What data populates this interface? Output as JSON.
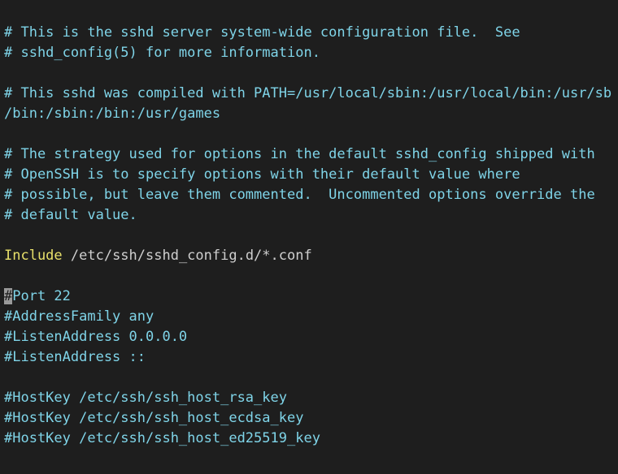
{
  "editor": {
    "file_lines": [
      "# This is the sshd server system-wide configuration file.  See",
      "# sshd_config(5) for more information.",
      "",
      "# This sshd was compiled with PATH=/usr/local/sbin:/usr/local/bin:/usr/sb",
      "/bin:/sbin:/bin:/usr/games",
      "",
      "# The strategy used for options in the default sshd_config shipped with",
      "# OpenSSH is to specify options with their default value where",
      "# possible, but leave them commented.  Uncommented options override the",
      "# default value.",
      "",
      "",
      "",
      "",
      "#AddressFamily any",
      "#ListenAddress 0.0.0.0",
      "#ListenAddress ::",
      "",
      "#HostKey /etc/ssh/ssh_host_rsa_key",
      "#HostKey /etc/ssh/ssh_host_ecdsa_key",
      "#HostKey /etc/ssh/ssh_host_ed25519_key"
    ],
    "include_keyword": "Include",
    "include_path": " /etc/ssh/sshd_config.d/*.conf",
    "cursor_char": "#",
    "port_line_rest": "Port 22"
  },
  "colors": {
    "background": "#1e1e1e",
    "comment": "#7fd4e8",
    "keyword": "#e8e06a",
    "plain": "#cfcfcf",
    "cursor": "#9a9a9a"
  }
}
